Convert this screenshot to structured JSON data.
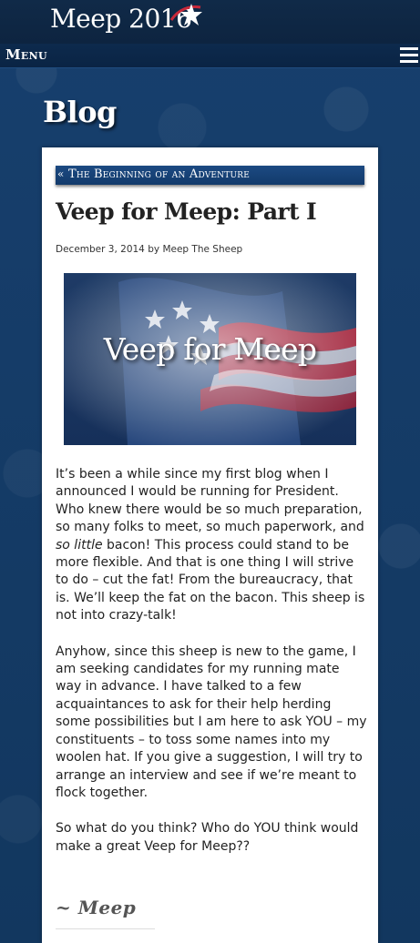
{
  "header": {
    "site_title": "Meep 2016",
    "menu_label": "Menu"
  },
  "page": {
    "heading": "Blog"
  },
  "post": {
    "nav_arrow": "«",
    "nav_label": "The Beginning of an Adventure",
    "title": "Veep for Meep: Part I",
    "date": "December 3, 2014",
    "by": "by",
    "author": "Meep The Sheep",
    "banner_text": "Veep for Meep",
    "p1_a": "It’s been a while since my first blog when I announced I would be running for President.  Who knew there would be so much preparation, so many folks to meet, so much paperwork, and ",
    "p1_em": "so little",
    "p1_b": " bacon! This process could stand to be more flexible.  And that is one thing I will strive to do – cut the fat!  From the bureaucracy, that is.  We’ll keep the fat on the bacon.  This sheep is not into crazy-talk!",
    "p2": "Anyhow, since this sheep is new to the game, I am seeking candidates for my running mate way in advance.  I have talked to a few acquaintances to ask for their help herding some possibilities but I am here to ask YOU – my constituents – to toss some names into my woolen hat.  If you give a suggestion, I will try to arrange an interview and see if we’re meant to flock together.",
    "p3": "So what do you think?  Who do YOU think would make a great Veep for Meep??",
    "signature": "~ Meep"
  },
  "colors": {
    "background": "#143a66",
    "header": "#0d2440",
    "nav_bar": "#1c4a82",
    "card": "#ffffff",
    "text": "#222222"
  },
  "icons": {
    "title_star": "star-icon",
    "menu": "hamburger-menu-icon",
    "nav_prev": "double-chevron-left-icon"
  }
}
